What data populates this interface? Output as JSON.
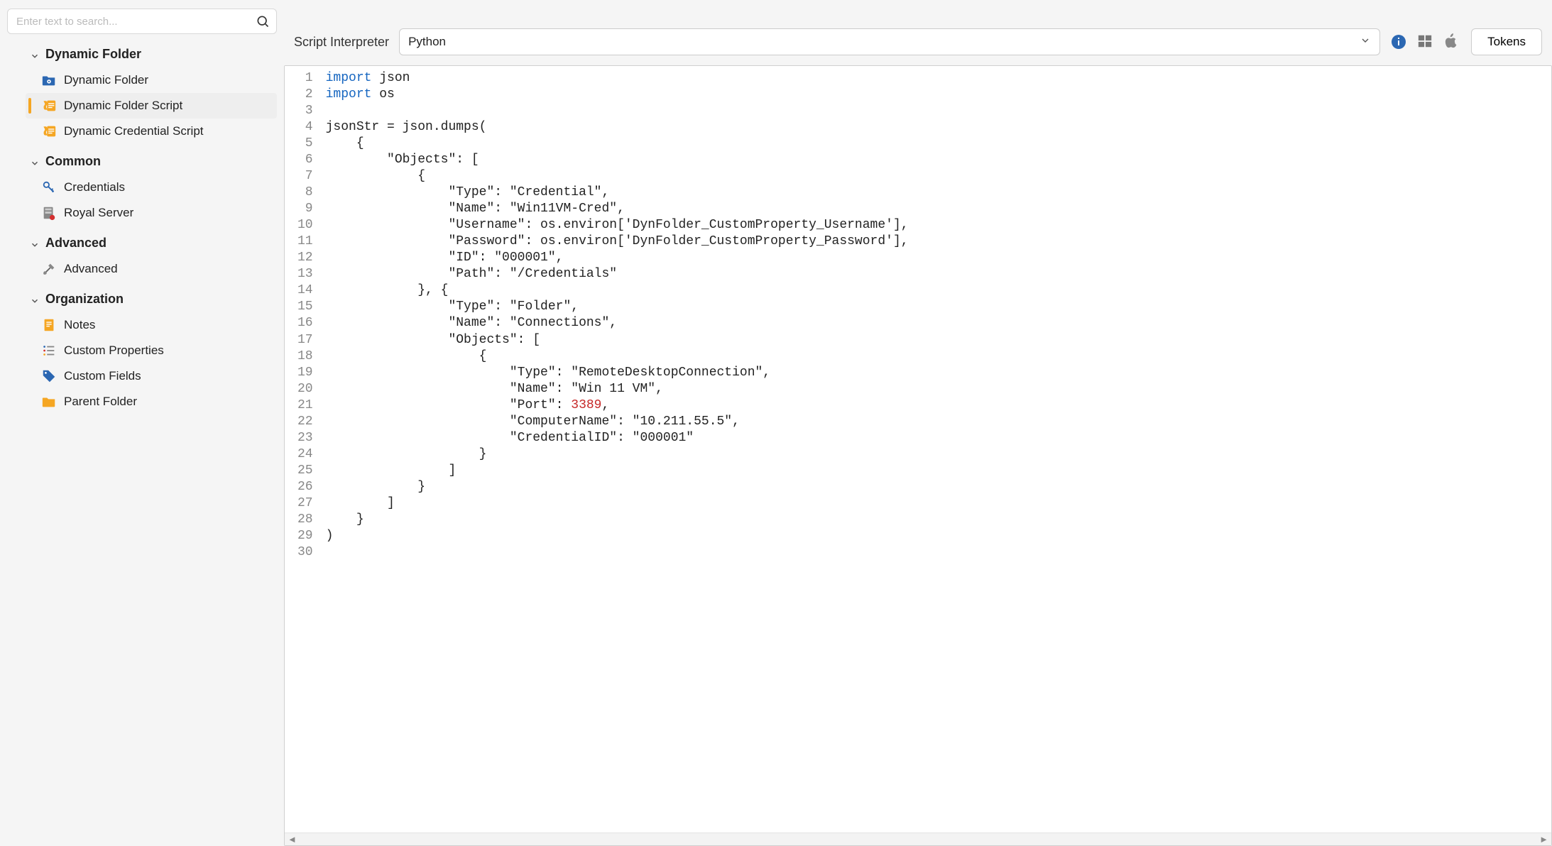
{
  "search": {
    "placeholder": "Enter text to search..."
  },
  "sidebar": {
    "sections": [
      {
        "title": "Dynamic Folder",
        "items": [
          {
            "label": "Dynamic Folder",
            "icon": "folder-gear",
            "selected": false
          },
          {
            "label": "Dynamic Folder Script",
            "icon": "script",
            "selected": true
          },
          {
            "label": "Dynamic Credential Script",
            "icon": "script",
            "selected": false
          }
        ]
      },
      {
        "title": "Common",
        "items": [
          {
            "label": "Credentials",
            "icon": "key",
            "selected": false
          },
          {
            "label": "Royal Server",
            "icon": "server",
            "selected": false
          }
        ]
      },
      {
        "title": "Advanced",
        "items": [
          {
            "label": "Advanced",
            "icon": "tools",
            "selected": false
          }
        ]
      },
      {
        "title": "Organization",
        "items": [
          {
            "label": "Notes",
            "icon": "note",
            "selected": false
          },
          {
            "label": "Custom Properties",
            "icon": "list",
            "selected": false
          },
          {
            "label": "Custom Fields",
            "icon": "tag",
            "selected": false
          },
          {
            "label": "Parent Folder",
            "icon": "folder",
            "selected": false
          }
        ]
      }
    ]
  },
  "toolbar": {
    "interpreter_label": "Script Interpreter",
    "interpreter_value": "Python",
    "tokens_label": "Tokens"
  },
  "editor": {
    "line_count": 30,
    "lines": [
      [
        {
          "t": "kw",
          "s": "import"
        },
        {
          "t": "",
          "s": " json"
        }
      ],
      [
        {
          "t": "kw",
          "s": "import"
        },
        {
          "t": "",
          "s": " os"
        }
      ],
      [],
      [
        {
          "t": "",
          "s": "jsonStr = json.dumps("
        }
      ],
      [
        {
          "t": "",
          "s": "    {"
        }
      ],
      [
        {
          "t": "",
          "s": "        \"Objects\": ["
        }
      ],
      [
        {
          "t": "",
          "s": "            {"
        }
      ],
      [
        {
          "t": "",
          "s": "                \"Type\": \"Credential\","
        }
      ],
      [
        {
          "t": "",
          "s": "                \"Name\": \"Win11VM-Cred\","
        }
      ],
      [
        {
          "t": "",
          "s": "                \"Username\": os.environ['DynFolder_CustomProperty_Username'],"
        }
      ],
      [
        {
          "t": "",
          "s": "                \"Password\": os.environ['DynFolder_CustomProperty_Password'],"
        }
      ],
      [
        {
          "t": "",
          "s": "                \"ID\": \"000001\","
        }
      ],
      [
        {
          "t": "",
          "s": "                \"Path\": \"/Credentials\""
        }
      ],
      [
        {
          "t": "",
          "s": "            }, {"
        }
      ],
      [
        {
          "t": "",
          "s": "                \"Type\": \"Folder\","
        }
      ],
      [
        {
          "t": "",
          "s": "                \"Name\": \"Connections\","
        }
      ],
      [
        {
          "t": "",
          "s": "                \"Objects\": ["
        }
      ],
      [
        {
          "t": "",
          "s": "                    {"
        }
      ],
      [
        {
          "t": "",
          "s": "                        \"Type\": \"RemoteDesktopConnection\","
        }
      ],
      [
        {
          "t": "",
          "s": "                        \"Name\": \"Win 11 VM\","
        }
      ],
      [
        {
          "t": "",
          "s": "                        \"Port\": "
        },
        {
          "t": "num",
          "s": "3389"
        },
        {
          "t": "",
          "s": ","
        }
      ],
      [
        {
          "t": "",
          "s": "                        \"ComputerName\": \"10.211.55.5\","
        }
      ],
      [
        {
          "t": "",
          "s": "                        \"CredentialID\": \"000001\""
        }
      ],
      [
        {
          "t": "",
          "s": "                    }"
        }
      ],
      [
        {
          "t": "",
          "s": "                ]"
        }
      ],
      [
        {
          "t": "",
          "s": "            }"
        }
      ],
      [
        {
          "t": "",
          "s": "        ]"
        }
      ],
      [
        {
          "t": "",
          "s": "    }"
        }
      ],
      [
        {
          "t": "",
          "s": ")"
        }
      ],
      []
    ]
  }
}
